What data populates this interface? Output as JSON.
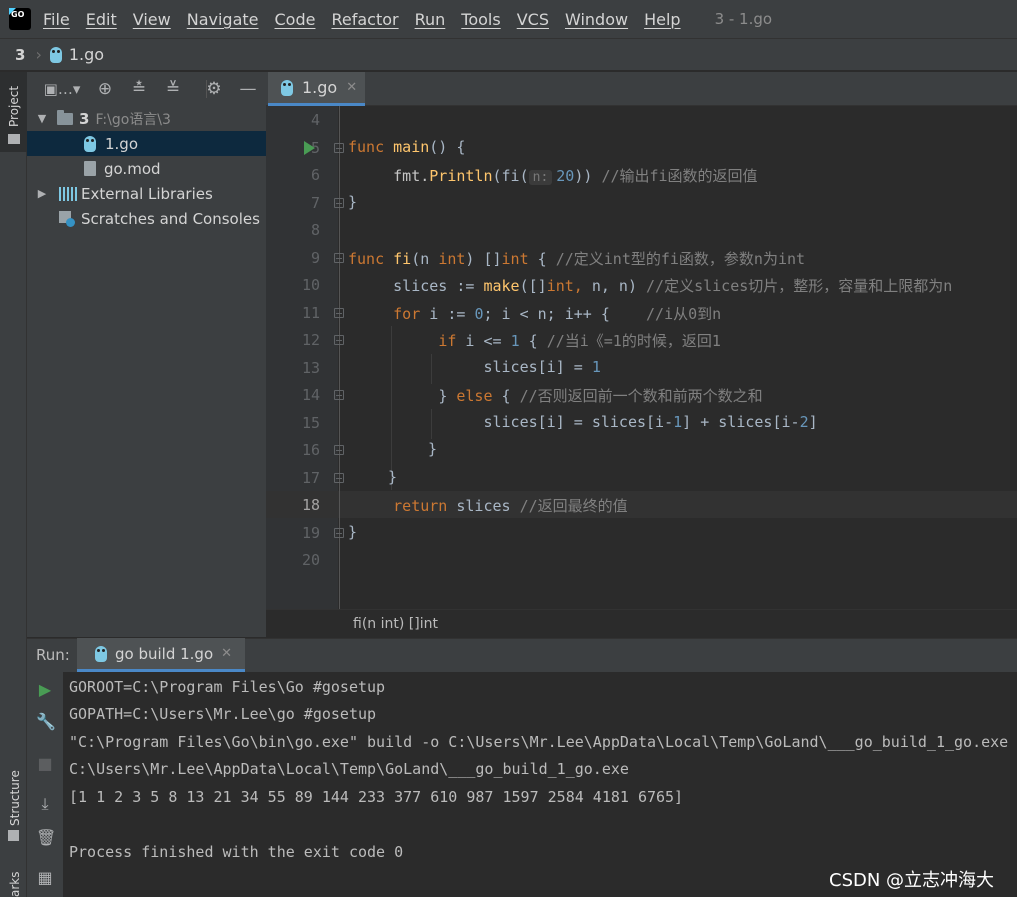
{
  "menubar": {
    "logo_icon": "goland-logo",
    "items": [
      "File",
      "Edit",
      "View",
      "Navigate",
      "Code",
      "Refactor",
      "Run",
      "Tools",
      "VCS",
      "Window",
      "Help"
    ],
    "window_title": "3 - 1.go"
  },
  "breadcrumb": {
    "root": "3",
    "file": "1.go"
  },
  "left_strip": {
    "project_tab": "Project",
    "structure_tab": "Structure",
    "bookmarks_tab": "arks"
  },
  "project": {
    "toolbar_icons": [
      "panel-icon",
      "locate-icon",
      "expand-all-icon",
      "collapse-all-icon",
      "gear-icon",
      "minimize-icon"
    ],
    "tree": {
      "root_name": "3",
      "root_path": "F:\\go语言\\3",
      "file_1": "1.go",
      "file_2": "go.mod",
      "external_libraries": "External Libraries",
      "scratches": "Scratches and Consoles"
    }
  },
  "editor": {
    "tab_label": "1.go",
    "line_numbers": [
      "4",
      "5",
      "6",
      "7",
      "8",
      "9",
      "10",
      "11",
      "12",
      "13",
      "14",
      "15",
      "16",
      "17",
      "18",
      "19",
      "20"
    ],
    "current_line": "18",
    "code": {
      "l5_kw": "func",
      "l5_fn": "main",
      "l5_rest": "() {",
      "l6_pkg": "fmt.",
      "l6_fn": "Println",
      "l6_a": "(fi(",
      "l6_hint": "n:",
      "l6_num": "20",
      "l6_b": ")) ",
      "l6_cmt": "//输出fi函数的返回值",
      "l7": "}",
      "l9_kw": "func",
      "l9_fn": "fi",
      "l9_a": "(n ",
      "l9_int": "int",
      "l9_b": ") []",
      "l9_int2": "int",
      "l9_c": " { ",
      "l9_cmt": "//定义int型的fi函数，参数n为int",
      "l10_a": "slices := ",
      "l10_fn": "make",
      "l10_b": "([]",
      "l10_int": "int, ",
      "l10_c": "n, n) ",
      "l10_cmt": "//定义slices切片，整形，容量和上限都为n",
      "l11_kw": "for",
      "l11_a": " i := ",
      "l11_num": "0",
      "l11_b": "; i < n; i++ {    ",
      "l11_cmt": "//i从0到n",
      "l12_kw": "if",
      "l12_a": " i <= ",
      "l12_num": "1",
      "l12_b": " { ",
      "l12_cmt": "//当i《=1的时候，返回1",
      "l13_a": "slices[i] = ",
      "l13_num": "1",
      "l14_a": "} ",
      "l14_kw": "else",
      "l14_b": " { ",
      "l14_cmt": "//否则返回前一个数和前两个数之和",
      "l15_a": "slices[i] = slices[i-",
      "l15_n1": "1",
      "l15_b": "] + slices[i-",
      "l15_n2": "2",
      "l15_c": "]",
      "l16": "}",
      "l17": "}",
      "l18_kw": "return",
      "l18_a": " slices ",
      "l18_cmt": "//返回最终的值",
      "l19": "}"
    },
    "signature_crumb": "fi(n int) []int"
  },
  "run_panel": {
    "label": "Run:",
    "tab_label": "go build 1.go",
    "side_icons": [
      "run-icon",
      "wrench-icon",
      "stop-icon",
      "scroll-to-end-icon",
      "trash-icon",
      "layout-icon"
    ],
    "console": [
      "GOROOT=C:\\Program Files\\Go #gosetup",
      "GOPATH=C:\\Users\\Mr.Lee\\go #gosetup",
      "\"C:\\Program Files\\Go\\bin\\go.exe\" build -o C:\\Users\\Mr.Lee\\AppData\\Local\\Temp\\GoLand\\___go_build_1_go.exe",
      "C:\\Users\\Mr.Lee\\AppData\\Local\\Temp\\GoLand\\___go_build_1_go.exe",
      "[1 1 2 3 5 8 13 21 34 55 89 144 233 377 610 987 1597 2584 4181 6765]",
      "",
      "Process finished with the exit code 0"
    ]
  },
  "watermark": "CSDN @立志冲海大"
}
